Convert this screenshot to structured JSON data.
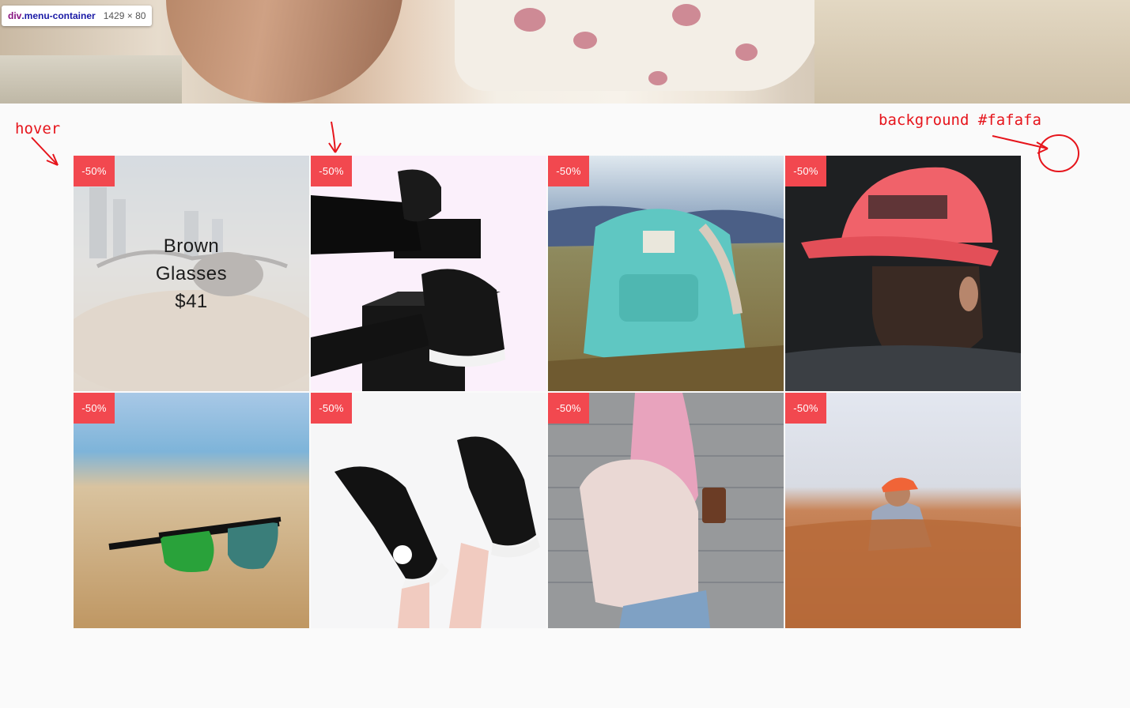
{
  "devtools": {
    "selector_tag": "div",
    "selector_class": ".menu-container",
    "size": "1429 × 80"
  },
  "annotations": {
    "hover_label": "hover",
    "background_label": "background #fafafa"
  },
  "colors": {
    "page_background": "#fafafa",
    "badge": "#f2484f",
    "annotation": "#e6141b"
  },
  "products": [
    {
      "badge": "-50%",
      "name_line1": "Brown",
      "name_line2": "Glasses",
      "price": "$41",
      "image": "sunglasses-on-sand-hover",
      "hovered": true
    },
    {
      "badge": "-50%",
      "image": "black-sneakers-on-box"
    },
    {
      "badge": "-50%",
      "image": "teal-backpack-in-field"
    },
    {
      "badge": "-50%",
      "image": "man-red-cap"
    },
    {
      "badge": "-50%",
      "image": "green-sunglasses-beach"
    },
    {
      "badge": "-50%",
      "image": "converse-sneakers"
    },
    {
      "badge": "-50%",
      "image": "woman-pink-backpack"
    },
    {
      "badge": "-50%",
      "image": "man-in-wheat-field"
    }
  ]
}
